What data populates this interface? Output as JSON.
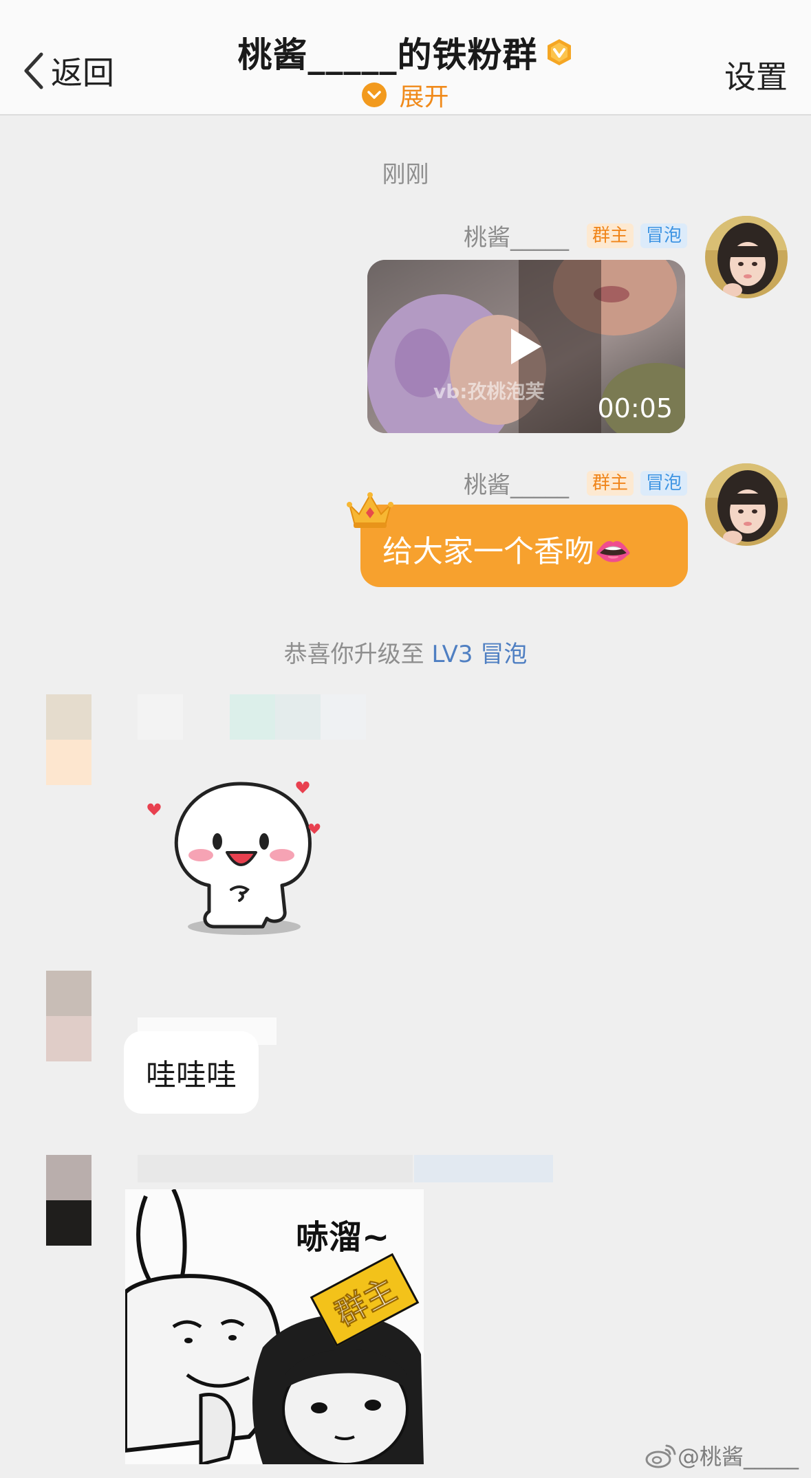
{
  "header": {
    "back_label": "返回",
    "title": "桃酱_____的铁粉群",
    "expand_label": "展开",
    "settings_label": "设置"
  },
  "chat": {
    "timestamp": "刚刚",
    "messages": [
      {
        "sender": "桃酱_____",
        "tags": [
          "群主",
          "冒泡"
        ],
        "video_duration": "00:05",
        "video_watermark": "vb:孜桃泡芙"
      },
      {
        "sender": "桃酱_____",
        "tags": [
          "群主",
          "冒泡"
        ],
        "text": "给大家一个香吻👄"
      }
    ],
    "upgrade_notice": {
      "prefix": "恭喜你升级至 ",
      "level": "LV3 冒泡"
    },
    "left_messages": [
      {
        "type": "sticker",
        "icon": "smiling-dumpling-sticker"
      },
      {
        "type": "text",
        "text": "哇哇哇"
      },
      {
        "type": "sticker",
        "icon": "rabbit-meme-sticker",
        "meme_text": "哧溜~",
        "meme_tag": "群主"
      }
    ]
  },
  "footer": {
    "watermark": "@桃酱_____"
  },
  "colors": {
    "accent_orange": "#f7a12e",
    "tag_owner": "#f0851a",
    "tag_bubble": "#3f95e3",
    "level_link": "#4f7fc2"
  }
}
